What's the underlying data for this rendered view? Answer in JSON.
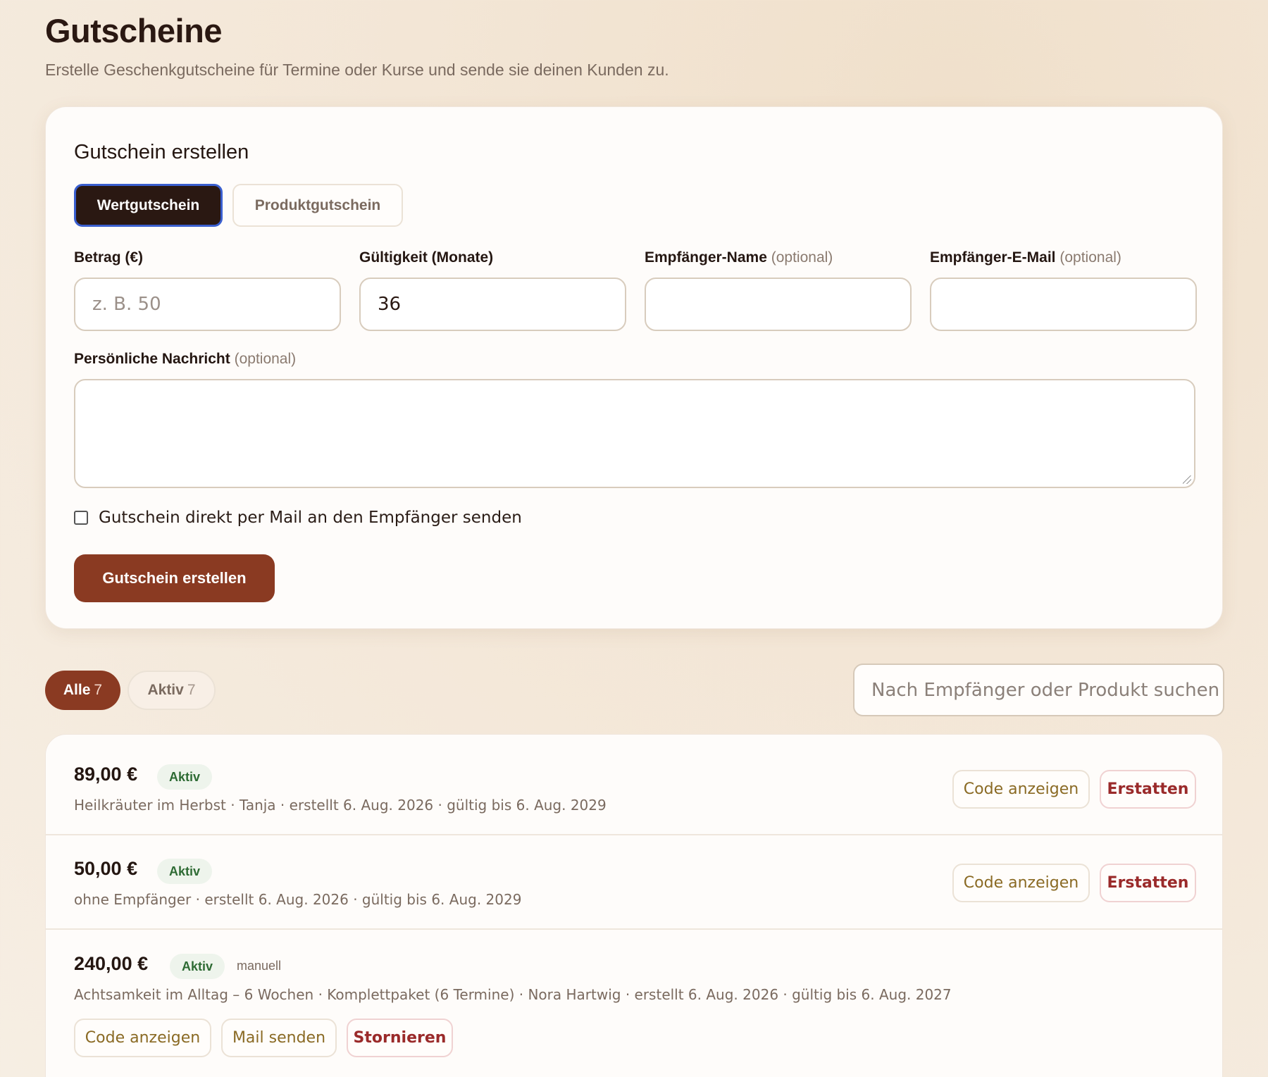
{
  "header": {
    "title": "Gutscheine",
    "subtitle": "Erstelle Geschenkgutscheine für Termine oder Kurse und sende sie deinen Kunden zu."
  },
  "create_card": {
    "title": "Gutschein erstellen",
    "types": {
      "active": "Wertgutschein",
      "inactive": "Produktgutschein"
    },
    "fields": {
      "amount": {
        "label": "Betrag (€)",
        "placeholder": "z. B. 50",
        "value": ""
      },
      "validity": {
        "label": "Gültigkeit (Monate)",
        "value": "36"
      },
      "recipient_name": {
        "label": "Empfänger-Name",
        "optional": "(optional)",
        "value": ""
      },
      "recipient_email": {
        "label": "Empfänger-E-Mail",
        "optional": "(optional)",
        "value": ""
      }
    },
    "message": {
      "label": "Persönliche Nachricht",
      "optional": "(optional)",
      "value": ""
    },
    "send_mail_checkbox": {
      "label": "Gutschein direkt per Mail an den Empfänger senden",
      "checked": false
    },
    "submit_label": "Gutschein erstellen"
  },
  "filters": {
    "all": {
      "label": "Alle",
      "count": "7"
    },
    "active": {
      "label": "Aktiv",
      "count": "7"
    },
    "search_placeholder": "Nach Empfänger oder Produkt suchen"
  },
  "vouchers": [
    {
      "amount": "89,00 €",
      "status": "Aktiv",
      "meta": "Heilkräuter im Herbst · Tanja · erstellt 6. Aug. 2026 · gültig bis 6. Aug. 2029",
      "actions": [
        "Code anzeigen",
        "Erstatten"
      ]
    },
    {
      "amount": "50,00 €",
      "status": "Aktiv",
      "meta": "ohne Empfänger · erstellt 6. Aug. 2026 · gültig bis 6. Aug. 2029",
      "actions": [
        "Code anzeigen",
        "Erstatten"
      ]
    },
    {
      "amount": "240,00 €",
      "status": "Aktiv",
      "tag": "manuell",
      "meta": "Achtsamkeit im Alltag – 6 Wochen · Komplettpaket (6 Termine) · Nora Hartwig · erstellt 6. Aug. 2026 · gültig bis 6. Aug. 2027",
      "actions": [
        "Code anzeigen",
        "Mail senden",
        "Stornieren"
      ]
    }
  ],
  "colors": {
    "accent": "#8a3a22",
    "dark": "#2a1812",
    "success_badge_bg": "#eef4ec",
    "success_badge_text": "#2e6b34",
    "danger_text": "#9a2a2a"
  }
}
